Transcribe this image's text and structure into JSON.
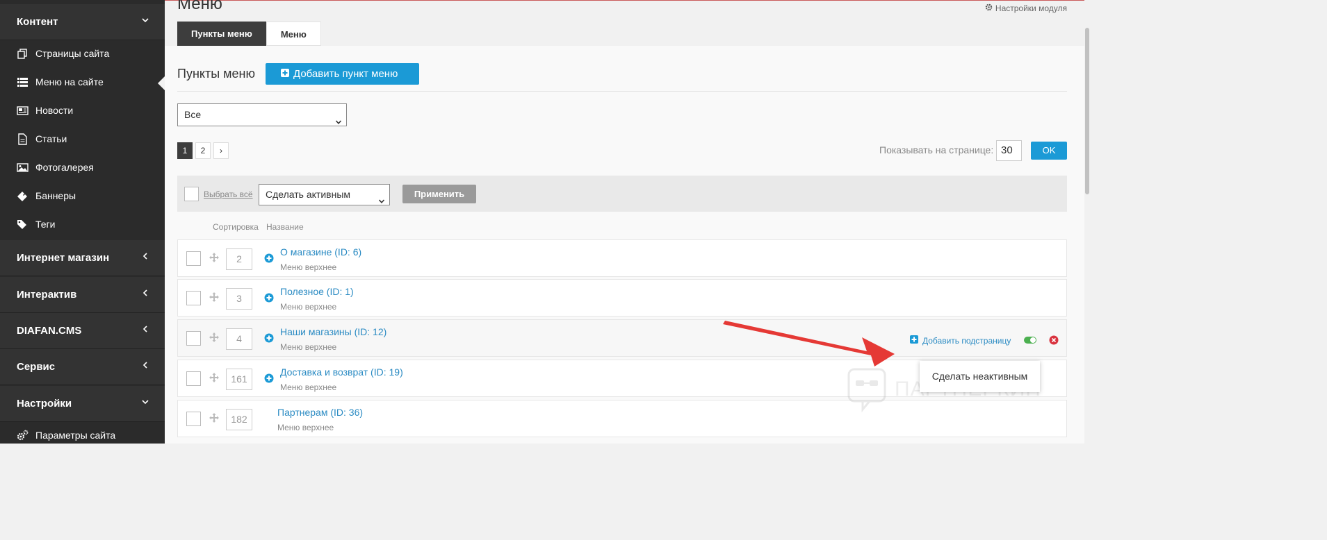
{
  "sidebar": {
    "sections": [
      {
        "label": "Контент",
        "expanded": true
      },
      {
        "label": "Интернет магазин",
        "expanded": false
      },
      {
        "label": "Интерактив",
        "expanded": false
      },
      {
        "label": "DIAFAN.CMS",
        "expanded": false
      },
      {
        "label": "Сервис",
        "expanded": false
      },
      {
        "label": "Настройки",
        "expanded": true
      }
    ],
    "content_items": [
      {
        "label": "Страницы сайта",
        "icon": "pages-icon"
      },
      {
        "label": "Меню на сайте",
        "icon": "list-icon",
        "active": true
      },
      {
        "label": "Новости",
        "icon": "news-icon"
      },
      {
        "label": "Статьи",
        "icon": "document-icon"
      },
      {
        "label": "Фотогалерея",
        "icon": "image-icon"
      },
      {
        "label": "Баннеры",
        "icon": "ticket-icon"
      },
      {
        "label": "Теги",
        "icon": "tags-icon"
      }
    ],
    "settings_items": [
      {
        "label": "Параметры сайта",
        "icon": "cogs-icon"
      }
    ]
  },
  "header": {
    "title": "Меню",
    "settings_link": "Настройки модуля"
  },
  "tabs": [
    {
      "label": "Пункты меню",
      "active": true
    },
    {
      "label": "Меню",
      "active": false
    }
  ],
  "section": {
    "title": "Пункты меню",
    "add_button": "Добавить пункт меню"
  },
  "filter": {
    "selected": "Все"
  },
  "pagination": {
    "pages": [
      "1",
      "2"
    ],
    "current": "1",
    "next": "›",
    "per_page_label": "Показывать на странице:",
    "per_page_value": "30",
    "ok": "OK"
  },
  "bulk": {
    "select_all": "Выбрать всё",
    "action": "Сделать активным",
    "apply": "Применить"
  },
  "columns": {
    "sort": "Сортировка",
    "name": "Название"
  },
  "rows": [
    {
      "sort": "2",
      "title": "О магазине (ID: 6)",
      "sub": "Меню верхнее",
      "has_children": true
    },
    {
      "sort": "3",
      "title": "Полезное (ID: 1)",
      "sub": "Меню верхнее",
      "has_children": true
    },
    {
      "sort": "4",
      "title": "Наши магазины (ID: 12)",
      "sub": "Меню верхнее",
      "has_children": true
    },
    {
      "sort": "161",
      "title": "Доставка и возврат (ID: 19)",
      "sub": "Меню верхнее",
      "has_children": true
    },
    {
      "sort": "182",
      "title": "Партнерам (ID: 36)",
      "sub": "Меню верхнее",
      "has_children": false
    }
  ],
  "row_actions": {
    "add_subpage": "Добавить подстраницу"
  },
  "tooltip": "Сделать неактивным",
  "watermark": "ПАРТНЕРКИН",
  "colors": {
    "accent": "#1b9ad6",
    "sidebar": "#2b2b2b",
    "link": "#2b8bc3",
    "arrow": "#e53935",
    "toggle_on": "#4cb050",
    "delete": "#d9333f"
  }
}
